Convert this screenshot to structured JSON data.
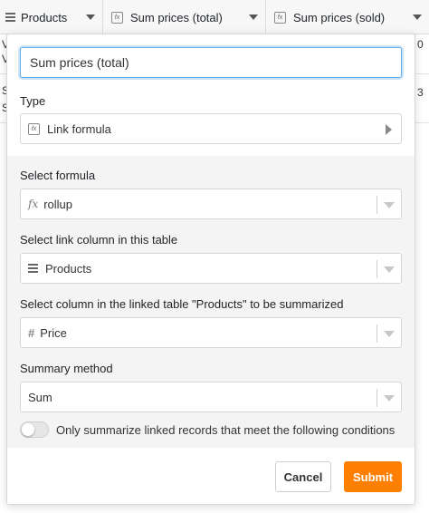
{
  "grid": {
    "columns": [
      {
        "label": "Products",
        "icon": "list-icon"
      },
      {
        "label": "Sum prices (total)",
        "icon": "formula-icon"
      },
      {
        "label": "Sum prices (sold)",
        "icon": "formula-icon"
      }
    ],
    "peek_left": [
      "V",
      "V",
      "S",
      "S"
    ],
    "peek_right": [
      "0",
      "3"
    ]
  },
  "popover": {
    "name_value": "Sum prices (total)",
    "type_label": "Type",
    "type_value": "Link formula",
    "formula_label": "Select formula",
    "formula_value": "rollup",
    "link_column_label": "Select link column in this table",
    "link_column_value": "Products",
    "summarize_column_label": "Select column in the linked table \"Products\" to be summarized",
    "summarize_column_value": "Price",
    "method_label": "Summary method",
    "method_value": "Sum",
    "toggle_label": "Only summarize linked records that meet the following conditions",
    "toggle_on": false,
    "cancel_label": "Cancel",
    "submit_label": "Submit"
  },
  "colors": {
    "accent": "#ff8000",
    "focus_border": "#66afe9",
    "panel_gray": "#f4f4f4"
  }
}
